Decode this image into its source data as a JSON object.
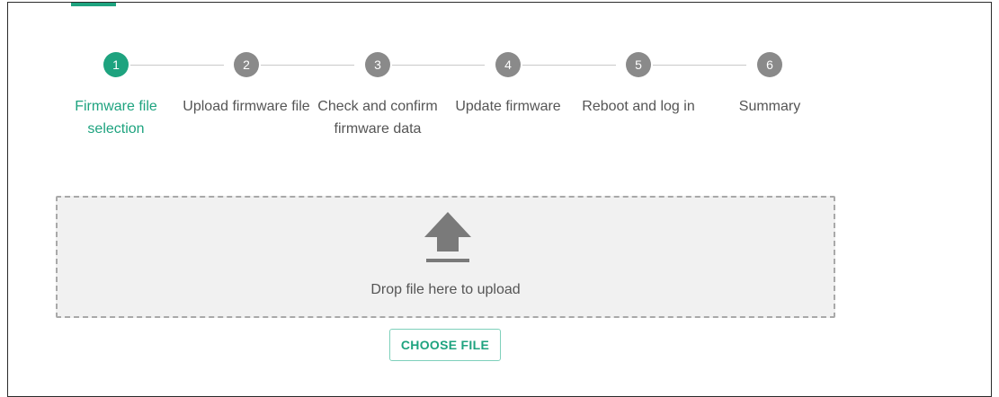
{
  "colors": {
    "accent": "#1ea37f",
    "inactive_step": "#8a8a8a",
    "text": "#555555",
    "dropzone_bg": "#f1f1f1",
    "dropzone_border": "#a9a9a9"
  },
  "stepper": {
    "active_step": 1,
    "steps": [
      {
        "number": "1",
        "label": "Firmware file selection"
      },
      {
        "number": "2",
        "label": "Upload firmware file"
      },
      {
        "number": "3",
        "label": "Check and confirm firmware data"
      },
      {
        "number": "4",
        "label": "Update firmware"
      },
      {
        "number": "5",
        "label": "Reboot and log in"
      },
      {
        "number": "6",
        "label": "Summary"
      }
    ]
  },
  "dropzone": {
    "icon": "upload-icon",
    "text": "Drop file here to upload"
  },
  "choose_button": {
    "label": "CHOOSE FILE"
  }
}
